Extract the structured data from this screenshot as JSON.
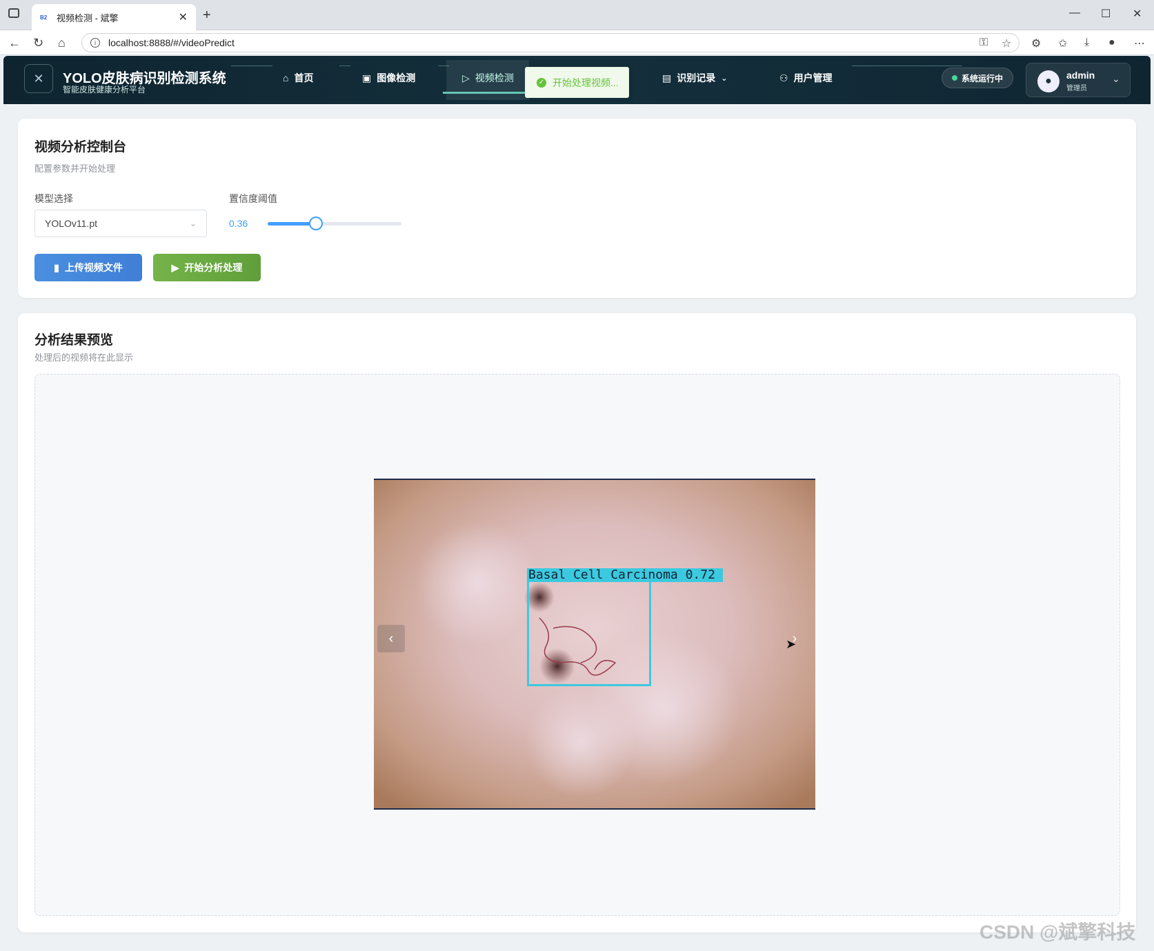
{
  "browser": {
    "tab_title": "视频检测 - 斌擎",
    "tab_favicon": "B2",
    "url": "localhost:8888/#/videoPredict"
  },
  "header": {
    "title": "YOLO皮肤病识别检测系统",
    "subtitle": "智能皮肤健康分析平台",
    "nav": [
      {
        "label": "首页",
        "icon": "home-icon"
      },
      {
        "label": "图像检测",
        "icon": "image-icon"
      },
      {
        "label": "视频检测",
        "icon": "play-circle-icon",
        "active": true
      },
      {
        "label": "识别记录",
        "icon": "document-icon"
      },
      {
        "label": "用户管理",
        "icon": "user-icon"
      }
    ],
    "status": "系统运行中",
    "user": {
      "name": "admin",
      "role": "管理员"
    }
  },
  "toast": {
    "message": "开始处理视频..."
  },
  "control": {
    "title": "视频分析控制台",
    "subtitle": "配置参数并开始处理",
    "model_label": "模型选择",
    "model_value": "YOLOv11.pt",
    "conf_label": "置信度阈值",
    "conf_value": "0.36",
    "conf_fraction": 0.36,
    "upload_label": "上传视频文件",
    "start_label": "开始分析处理"
  },
  "preview": {
    "title": "分析结果预览",
    "subtitle": "处理后的视频将在此显示",
    "detection_label": "Basal Cell Carcinoma 0.72"
  },
  "watermark": "CSDN @斌擎科技",
  "colors": {
    "accent": "#409eff",
    "success": "#67c23a",
    "bbox": "#3cc9df",
    "header_bg": "#142f3c"
  }
}
